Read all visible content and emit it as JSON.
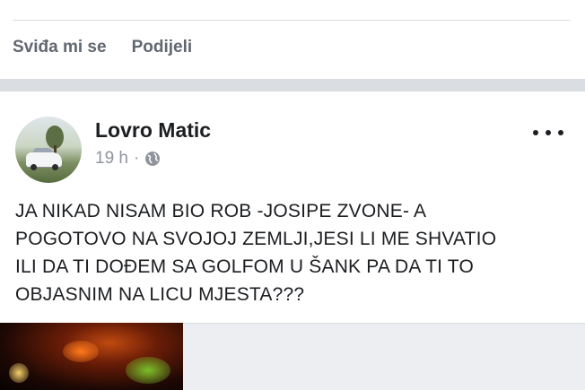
{
  "previous_post": {
    "actions": {
      "like_label": "Sviđa mi se",
      "share_label": "Podijeli"
    }
  },
  "post": {
    "author": "Lovro Matic",
    "timestamp": "19 h",
    "separator": "·",
    "privacy_icon": "globe-icon",
    "more_icon": "more-options-icon",
    "text_lines": [
      "JA NIKAD NISAM BIO ROB -JOSIPE ZVONE- A",
      "POGOTOVO NA SVOJOJ ZEMLJI,JESI LI ME SHVATIO",
      "ILI DA TI DOĐEM SA GOLFOM U ŠANK PA DA TI TO",
      "OBJASNIM NA LICU MJESTA???"
    ]
  },
  "colors": {
    "text_primary": "#1c1e21",
    "text_secondary": "#606770",
    "meta_gray": "#90949c",
    "separator_gray": "#dadde1"
  }
}
